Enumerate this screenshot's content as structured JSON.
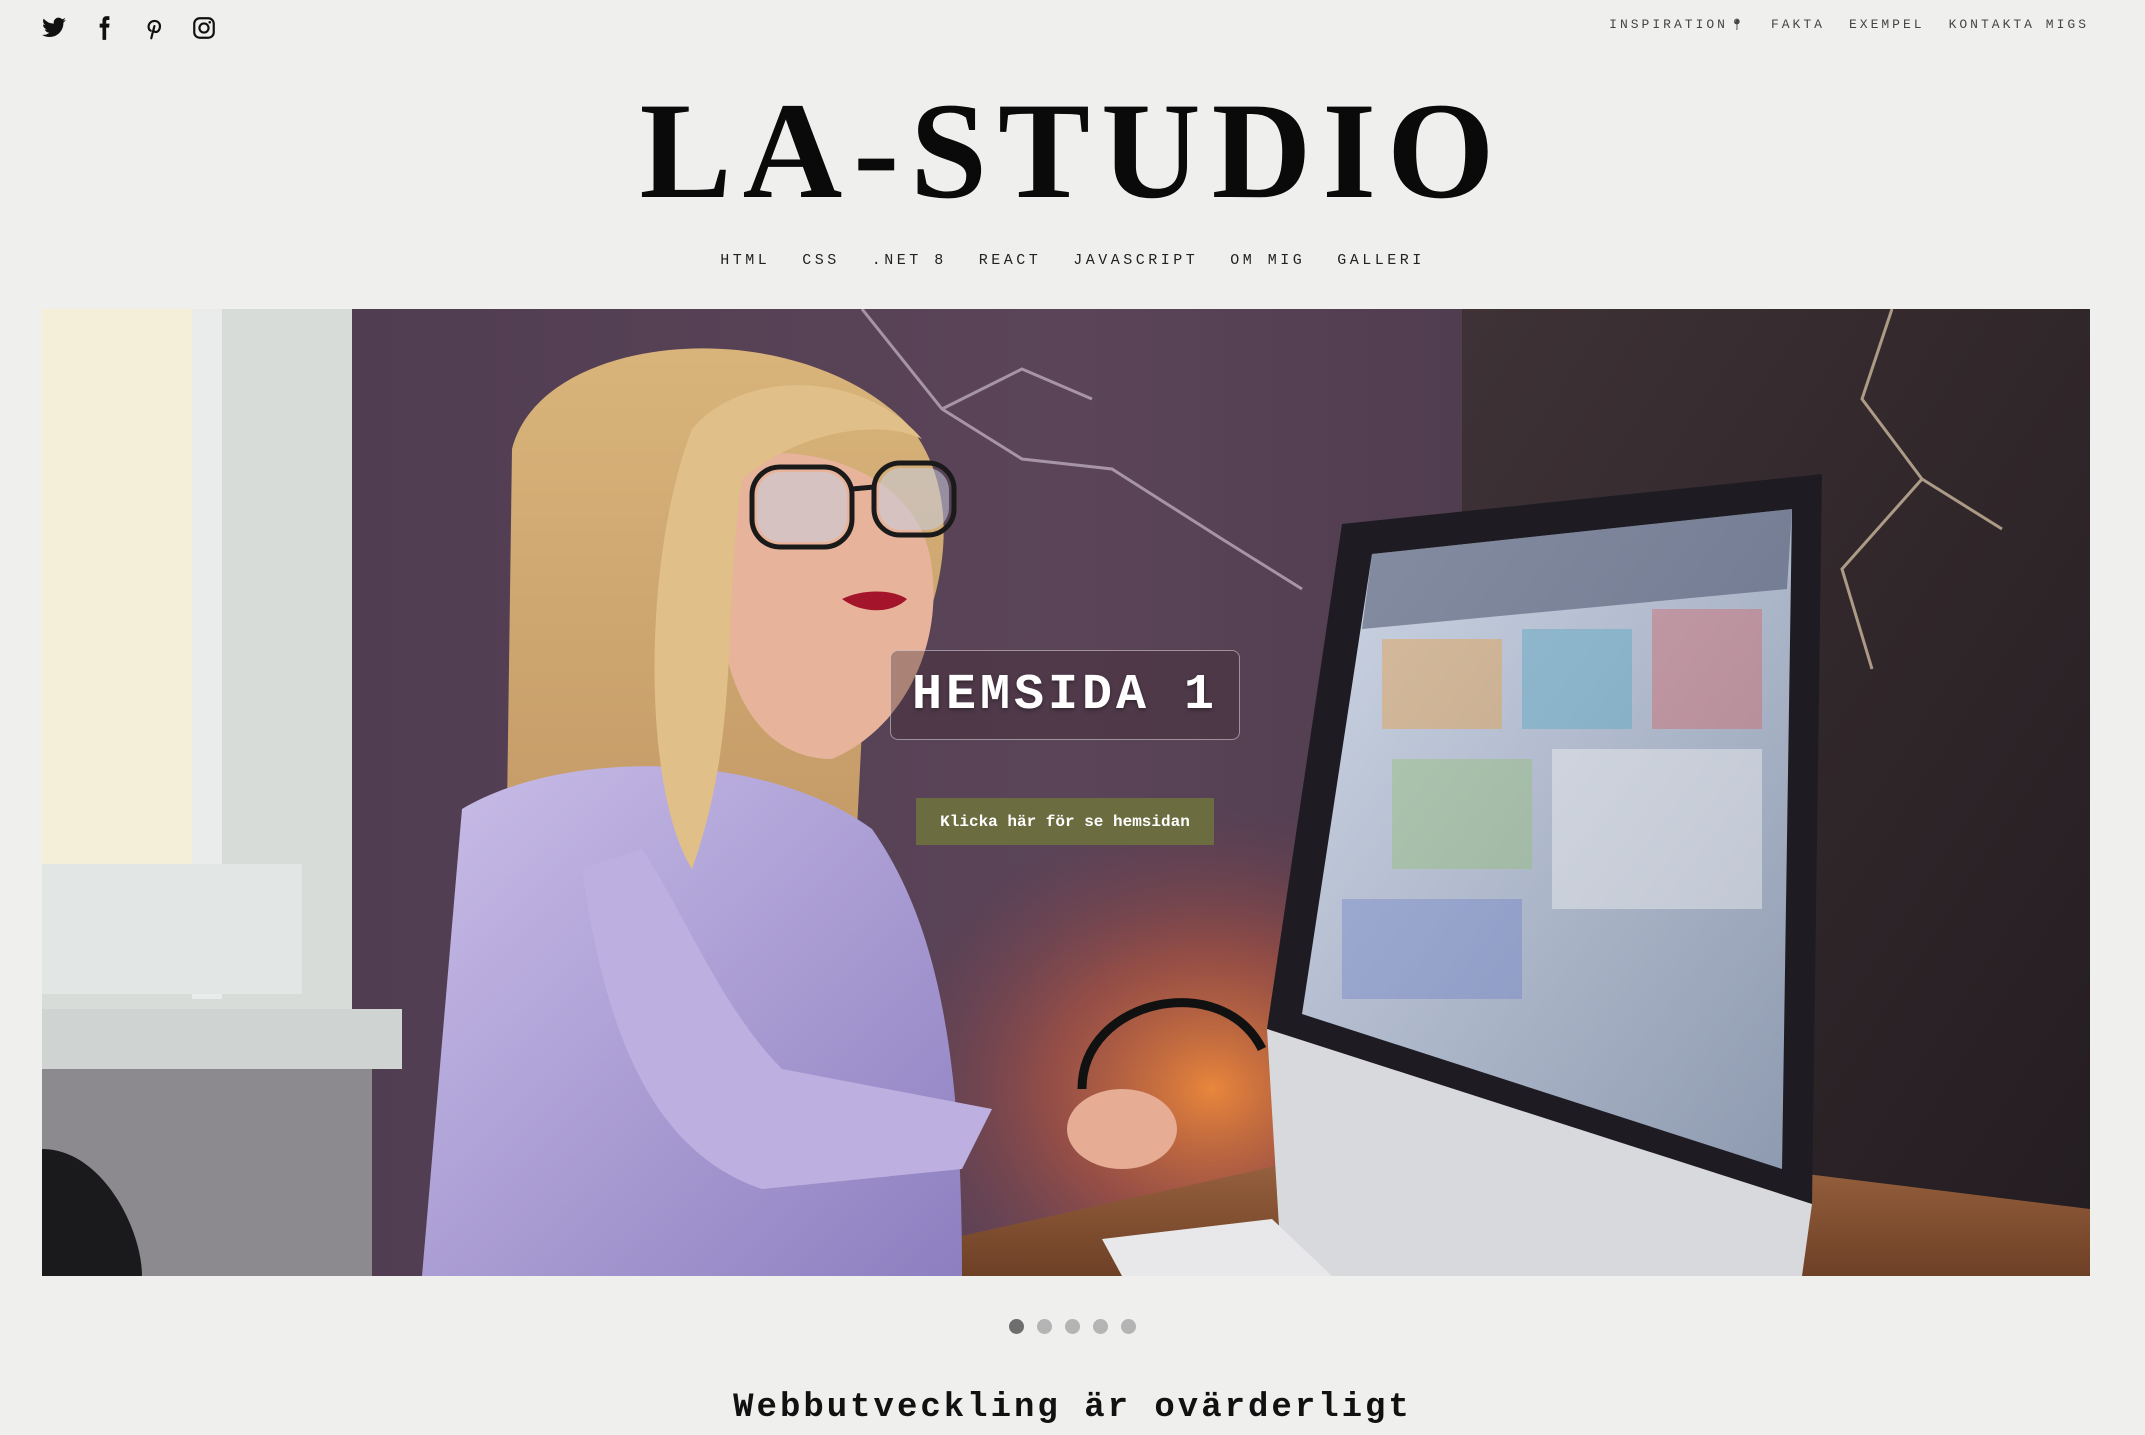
{
  "social": {
    "icons": [
      "twitter-icon",
      "facebook-icon",
      "pinterest-icon",
      "instagram-icon"
    ]
  },
  "top_nav": {
    "items": [
      {
        "label": "INSPIRATION",
        "icon": "pin-icon"
      },
      {
        "label": "FAKTA"
      },
      {
        "label": "EXEMPEL"
      },
      {
        "label": "KONTAKTA MIGS"
      }
    ]
  },
  "logo": {
    "text": "LA-STUDIO"
  },
  "main_nav": {
    "items": [
      "HTML",
      "CSS",
      ".NET 8",
      "REACT",
      "JAVASCRIPT",
      "OM MIG",
      "GALLERI"
    ]
  },
  "hero": {
    "title": "HEMSIDA 1",
    "button_label": "Klicka här för se hemsidan",
    "button_color": "#6b6d40"
  },
  "carousel": {
    "slide_count": 5,
    "active_index": 0
  },
  "section": {
    "heading": "Webbutveckling är ovärderligt"
  },
  "colors": {
    "page_background": "#efefee",
    "text": "#111111",
    "dot_active": "#6e6e6e",
    "dot_inactive": "#b4b4b4"
  }
}
